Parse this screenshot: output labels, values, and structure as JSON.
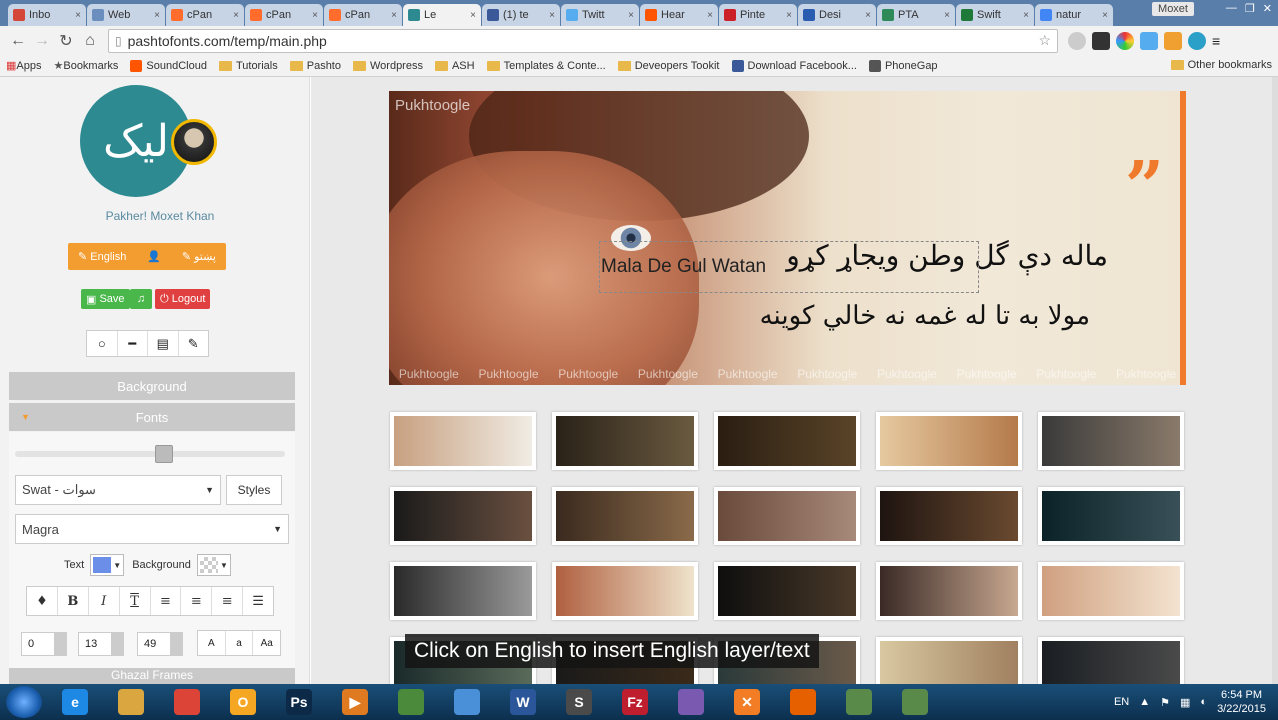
{
  "tabs": [
    {
      "label": "Inbo",
      "icon": "gmail-icon",
      "color": "#d44638",
      "active": false
    },
    {
      "label": "Web",
      "icon": "page-icon",
      "color": "#6a8fbf",
      "active": false
    },
    {
      "label": "cPan",
      "icon": "cpanel-icon",
      "color": "#ff6c2c",
      "active": false
    },
    {
      "label": "cPan",
      "icon": "cpanel-icon",
      "color": "#ff6c2c",
      "active": false
    },
    {
      "label": "cPan",
      "icon": "cpanel-icon",
      "color": "#ff6c2c",
      "active": false
    },
    {
      "label": "Le",
      "icon": "site-icon",
      "color": "#2d8a91",
      "active": true
    },
    {
      "label": "(1) te",
      "icon": "facebook-icon",
      "color": "#3b5998",
      "active": false
    },
    {
      "label": "Twitt",
      "icon": "twitter-icon",
      "color": "#55acee",
      "active": false
    },
    {
      "label": "Hear",
      "icon": "soundcloud-icon",
      "color": "#ff5500",
      "active": false
    },
    {
      "label": "Pinte",
      "icon": "pinterest-icon",
      "color": "#cb2027",
      "active": false
    },
    {
      "label": "Desi",
      "icon": "design-icon",
      "color": "#2a5db0",
      "active": false
    },
    {
      "label": "PTA",
      "icon": "pta-icon",
      "color": "#2e8b57",
      "active": false
    },
    {
      "label": "Swift",
      "icon": "swift-icon",
      "color": "#1f7a3a",
      "active": false
    },
    {
      "label": "natur",
      "icon": "google-icon",
      "color": "#4285f4",
      "active": false
    }
  ],
  "window": {
    "user": "Moxet"
  },
  "toolbar": {
    "url": "pashtofonts.com/temp/main.php"
  },
  "bookmarks": {
    "items": [
      {
        "label": "Apps",
        "icon": "apps-icon"
      },
      {
        "label": "Bookmarks",
        "icon": "star-icon"
      },
      {
        "label": "SoundCloud",
        "icon": "soundcloud-icon"
      },
      {
        "label": "Tutorials",
        "icon": "folder-icon"
      },
      {
        "label": "Pashto",
        "icon": "folder-icon"
      },
      {
        "label": "Wordpress",
        "icon": "folder-icon"
      },
      {
        "label": "ASH",
        "icon": "folder-icon"
      },
      {
        "label": "Templates & Conte...",
        "icon": "folder-icon"
      },
      {
        "label": "Deveopers Tookit",
        "icon": "folder-icon"
      },
      {
        "label": "Download Facebook...",
        "icon": "facebook-icon"
      },
      {
        "label": "PhoneGap",
        "icon": "phonegap-icon"
      }
    ],
    "other": "Other bookmarks"
  },
  "sidebar": {
    "logo_text": "ليک",
    "username": "Pakher! Moxet Khan",
    "lang_english": "English",
    "lang_pashto": "پښتو",
    "save": "Save",
    "logout": "Logout",
    "background_panel": "Background",
    "fonts_panel": "Fonts",
    "font_select": "Swat - سوات",
    "styles": "Styles",
    "family_select": "Magra",
    "text_label": "Text",
    "background_label": "Background",
    "text_color": "#6b8fe8",
    "spin1": "0",
    "spin2": "13",
    "spin3": "49",
    "case_upper": "A",
    "case_lower": "a",
    "case_title": "Aa",
    "next_panel": "Ghazal Frames"
  },
  "poster": {
    "brand": "Pukhtoogle",
    "pashto_line1": "ماله دې گل وطن ويجاړ کړو",
    "pashto_line2": "مولا به تا له غمه نه خالي کوينه",
    "english_text": "Mala De Gul Watan",
    "watermarks": [
      "Pukhtoogle",
      "Pukhtoogle",
      "Pukhtoogle",
      "Pukhtoogle",
      "Pukhtoogle",
      "Pukhtoogle",
      "Pukhtoogle",
      "Pukhtoogle",
      "Pukhtoogle",
      "Pukhtoogle"
    ]
  },
  "thumbnails": [
    [
      "#c8a080",
      "#f0ece4"
    ],
    [
      "#2a2218",
      "#6a5a40"
    ],
    [
      "#2a1e12",
      "#5a4428"
    ],
    [
      "#e6c9a0",
      "#b47a4a"
    ],
    [
      "#3a3a3a",
      "#8a7a6a"
    ],
    [
      "#1a1a1a",
      "#6a5040"
    ],
    [
      "#3a2a1e",
      "#8a6a4a"
    ],
    [
      "#6a4a3a",
      "#a88a7a"
    ],
    [
      "#1e1410",
      "#6a4a30"
    ],
    [
      "#0a2228",
      "#3a5058"
    ],
    [
      "#2a2a2a",
      "#9a9a9a"
    ],
    [
      "#b06040",
      "#efe3cc"
    ],
    [
      "#0e0e0e",
      "#4a3a2a"
    ],
    [
      "#3a2a26",
      "#c8a890"
    ],
    [
      "#d0a080",
      "#f3e3d0"
    ],
    [
      "#1a2a2a",
      "#5a6a5a"
    ],
    [
      "#1a1a1a",
      "#3a2a1a"
    ],
    [
      "#2a3a3a",
      "#6a5a4a"
    ],
    [
      "#d8c8a0",
      "#a08060"
    ],
    [
      "#1a1e22",
      "#4a4a4a"
    ]
  ],
  "caption": "Click on English to insert English layer/text",
  "taskbar": {
    "apps": [
      {
        "name": "ie-icon",
        "color": "#1e88e5",
        "glyph": "e"
      },
      {
        "name": "explorer-icon",
        "color": "#d9a640",
        "glyph": ""
      },
      {
        "name": "chrome-icon",
        "color": "#db4437",
        "glyph": ""
      },
      {
        "name": "outlook-icon",
        "color": "#f5a623",
        "glyph": "O"
      },
      {
        "name": "photoshop-icon",
        "color": "#0c2a48",
        "glyph": "Ps"
      },
      {
        "name": "media-icon",
        "color": "#e07a20",
        "glyph": "▶"
      },
      {
        "name": "dreamweaver-icon",
        "color": "#4a8a3a",
        "glyph": ""
      },
      {
        "name": "app-icon",
        "color": "#4a90d9",
        "glyph": ""
      },
      {
        "name": "word-icon",
        "color": "#2b579a",
        "glyph": "W"
      },
      {
        "name": "sublime-icon",
        "color": "#4a4a4a",
        "glyph": "S"
      },
      {
        "name": "filezilla-icon",
        "color": "#bf1e2e",
        "glyph": "Fz"
      },
      {
        "name": "eclipse-icon",
        "color": "#7a5ab0",
        "glyph": ""
      },
      {
        "name": "xampp-icon",
        "color": "#f27d25",
        "glyph": "✕"
      },
      {
        "name": "firefox-icon",
        "color": "#e66000",
        "glyph": ""
      },
      {
        "name": "app2-icon",
        "color": "#5a8a4a",
        "glyph": ""
      },
      {
        "name": "app3-icon",
        "color": "#5a8a4a",
        "glyph": ""
      }
    ],
    "lang": "EN",
    "time": "6:54 PM",
    "date": "3/22/2015"
  }
}
